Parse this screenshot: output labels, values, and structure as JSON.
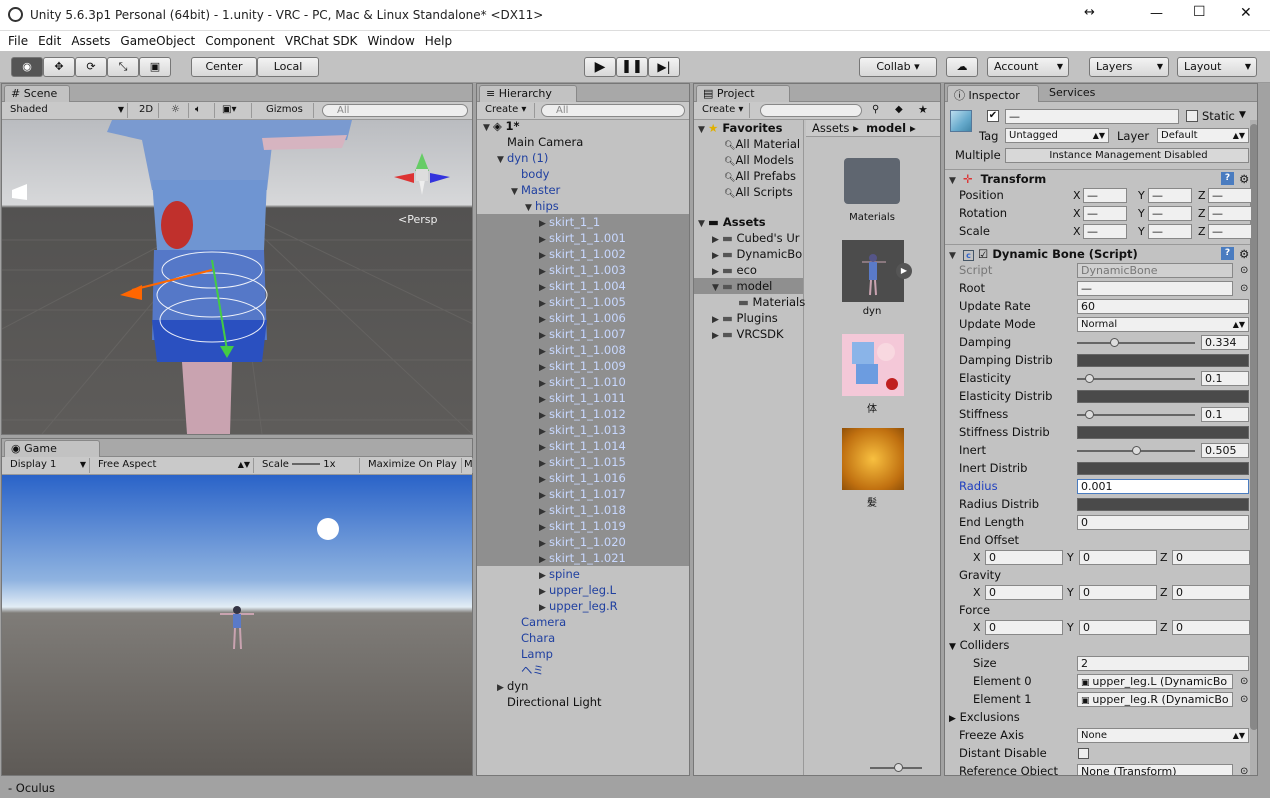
{
  "window": {
    "title": "Unity 5.6.3p1 Personal (64bit) - 1.unity - VRC - PC, Mac & Linux Standalone* <DX11>",
    "min": "—",
    "max": "☐",
    "close": "✕",
    "resize": "↔"
  },
  "menu": [
    "File",
    "Edit",
    "Assets",
    "GameObject",
    "Component",
    "VRChat SDK",
    "Window",
    "Help"
  ],
  "toolbar": {
    "center": "Center",
    "local": "Local",
    "collab": "Collab ▾",
    "account": "Account",
    "layers": "Layers",
    "layout": "Layout"
  },
  "scene": {
    "tab": "Scene",
    "shading": "Shaded",
    "mode2d": "2D",
    "gizmos": "Gizmos",
    "search_placeholder": "All",
    "persp": "Persp"
  },
  "game": {
    "tab": "Game",
    "display": "Display 1",
    "aspect": "Free Aspect",
    "scale_label": "Scale",
    "scale_value": "1x",
    "maximize": "Maximize On Play",
    "more": "M"
  },
  "hierarchy": {
    "tab": "Hierarchy",
    "create": "Create ▾",
    "search_placeholder": "All",
    "rows": [
      {
        "text": "1*",
        "indent": 0,
        "arrow": "▼",
        "style": "bold",
        "sel": false
      },
      {
        "text": "Main Camera",
        "indent": 1,
        "arrow": "",
        "style": "",
        "sel": false
      },
      {
        "text": "dyn (1)",
        "indent": 1,
        "arrow": "▼",
        "style": "blue",
        "sel": false
      },
      {
        "text": "body",
        "indent": 2,
        "arrow": "",
        "style": "blue",
        "sel": false
      },
      {
        "text": "Master",
        "indent": 2,
        "arrow": "▼",
        "style": "blue",
        "sel": false
      },
      {
        "text": "hips",
        "indent": 3,
        "arrow": "▼",
        "style": "blue",
        "sel": false
      },
      {
        "text": "skirt_1_1",
        "indent": 4,
        "arrow": "▶",
        "style": "lblue",
        "sel": true
      },
      {
        "text": "skirt_1_1.001",
        "indent": 4,
        "arrow": "▶",
        "style": "lblue",
        "sel": true
      },
      {
        "text": "skirt_1_1.002",
        "indent": 4,
        "arrow": "▶",
        "style": "lblue",
        "sel": true
      },
      {
        "text": "skirt_1_1.003",
        "indent": 4,
        "arrow": "▶",
        "style": "lblue",
        "sel": true
      },
      {
        "text": "skirt_1_1.004",
        "indent": 4,
        "arrow": "▶",
        "style": "lblue",
        "sel": true
      },
      {
        "text": "skirt_1_1.005",
        "indent": 4,
        "arrow": "▶",
        "style": "lblue",
        "sel": true
      },
      {
        "text": "skirt_1_1.006",
        "indent": 4,
        "arrow": "▶",
        "style": "lblue",
        "sel": true
      },
      {
        "text": "skirt_1_1.007",
        "indent": 4,
        "arrow": "▶",
        "style": "lblue",
        "sel": true
      },
      {
        "text": "skirt_1_1.008",
        "indent": 4,
        "arrow": "▶",
        "style": "lblue",
        "sel": true
      },
      {
        "text": "skirt_1_1.009",
        "indent": 4,
        "arrow": "▶",
        "style": "lblue",
        "sel": true
      },
      {
        "text": "skirt_1_1.010",
        "indent": 4,
        "arrow": "▶",
        "style": "lblue",
        "sel": true
      },
      {
        "text": "skirt_1_1.011",
        "indent": 4,
        "arrow": "▶",
        "style": "lblue",
        "sel": true
      },
      {
        "text": "skirt_1_1.012",
        "indent": 4,
        "arrow": "▶",
        "style": "lblue",
        "sel": true
      },
      {
        "text": "skirt_1_1.013",
        "indent": 4,
        "arrow": "▶",
        "style": "lblue",
        "sel": true
      },
      {
        "text": "skirt_1_1.014",
        "indent": 4,
        "arrow": "▶",
        "style": "lblue",
        "sel": true
      },
      {
        "text": "skirt_1_1.015",
        "indent": 4,
        "arrow": "▶",
        "style": "lblue",
        "sel": true
      },
      {
        "text": "skirt_1_1.016",
        "indent": 4,
        "arrow": "▶",
        "style": "lblue",
        "sel": true
      },
      {
        "text": "skirt_1_1.017",
        "indent": 4,
        "arrow": "▶",
        "style": "lblue",
        "sel": true
      },
      {
        "text": "skirt_1_1.018",
        "indent": 4,
        "arrow": "▶",
        "style": "lblue",
        "sel": true
      },
      {
        "text": "skirt_1_1.019",
        "indent": 4,
        "arrow": "▶",
        "style": "lblue",
        "sel": true
      },
      {
        "text": "skirt_1_1.020",
        "indent": 4,
        "arrow": "▶",
        "style": "lblue",
        "sel": true
      },
      {
        "text": "skirt_1_1.021",
        "indent": 4,
        "arrow": "▶",
        "style": "lblue",
        "sel": true
      },
      {
        "text": "spine",
        "indent": 4,
        "arrow": "▶",
        "style": "blue",
        "sel": false
      },
      {
        "text": "upper_leg.L",
        "indent": 4,
        "arrow": "▶",
        "style": "blue",
        "sel": false
      },
      {
        "text": "upper_leg.R",
        "indent": 4,
        "arrow": "▶",
        "style": "blue",
        "sel": false
      },
      {
        "text": "Camera",
        "indent": 2,
        "arrow": "",
        "style": "blue",
        "sel": false
      },
      {
        "text": "Chara",
        "indent": 2,
        "arrow": "",
        "style": "blue",
        "sel": false
      },
      {
        "text": "Lamp",
        "indent": 2,
        "arrow": "",
        "style": "blue",
        "sel": false
      },
      {
        "text": "ヘミ",
        "indent": 2,
        "arrow": "",
        "style": "blue",
        "sel": false
      },
      {
        "text": "dyn",
        "indent": 1,
        "arrow": "▶",
        "style": "",
        "sel": false
      },
      {
        "text": "Directional Light",
        "indent": 1,
        "arrow": "",
        "style": "",
        "sel": false
      }
    ]
  },
  "project": {
    "tab": "Project",
    "create": "Create ▾",
    "favorites": "Favorites",
    "fav_items": [
      "All Material",
      "All Models",
      "All Prefabs",
      "All Scripts"
    ],
    "assets": "Assets",
    "tree": [
      {
        "text": "Cubed's Ur",
        "indent": 1
      },
      {
        "text": "DynamicBo",
        "indent": 1
      },
      {
        "text": "eco",
        "indent": 1
      },
      {
        "text": "model",
        "indent": 1,
        "sel": true
      },
      {
        "text": "Materials",
        "indent": 2
      },
      {
        "text": "Plugins",
        "indent": 1
      },
      {
        "text": "VRCSDK",
        "indent": 1
      }
    ],
    "breadcrumb": [
      "Assets ▸",
      "model ▸"
    ],
    "grid": [
      {
        "label": "Materials"
      },
      {
        "label": "dyn"
      },
      {
        "label": "体"
      },
      {
        "label": "髪"
      }
    ]
  },
  "inspector": {
    "tab": "Inspector",
    "services": "Services",
    "static": "Static",
    "name_value": "—",
    "tag_label": "Tag",
    "tag": "Untagged",
    "layer_label": "Layer",
    "layer": "Default",
    "multiple_label": "Multiple",
    "multiple_value": "Instance Management Disabled",
    "transform": {
      "title": "Transform",
      "position": "Position",
      "rotation": "Rotation",
      "scale": "Scale",
      "mixed": "—"
    },
    "dynbone": {
      "title": "Dynamic Bone (Script)",
      "script_label": "Script",
      "script": "DynamicBone",
      "root_label": "Root",
      "root": "—",
      "update_rate_label": "Update Rate",
      "update_rate": "60",
      "update_mode_label": "Update Mode",
      "update_mode": "Normal",
      "damping_label": "Damping",
      "damping": "0.334",
      "damping_d": "Damping Distrib",
      "elasticity_label": "Elasticity",
      "elasticity": "0.1",
      "elasticity_d": "Elasticity Distrib",
      "stiffness_label": "Stiffness",
      "stiffness": "0.1",
      "stiffness_d": "Stiffness Distrib",
      "inert_label": "Inert",
      "inert": "0.505",
      "inert_d": "Inert Distrib",
      "radius_label": "Radius",
      "radius": "0.001",
      "radius_d": "Radius Distrib",
      "end_length_label": "End Length",
      "end_length": "0",
      "end_offset_label": "End Offset",
      "gravity_label": "Gravity",
      "force_label": "Force",
      "zero": "0",
      "colliders_label": "Colliders",
      "size_label": "Size",
      "size": "2",
      "el0_label": "Element 0",
      "el0": "upper_leg.L (DynamicBo",
      "el1_label": "Element 1",
      "el1": "upper_leg.R (DynamicBo",
      "exclusions_label": "Exclusions",
      "freeze_label": "Freeze Axis",
      "freeze": "None",
      "distant_label": "Distant Disable",
      "ref_label": "Reference Object",
      "ref": "None (Transform)"
    }
  },
  "status": "- Oculus"
}
